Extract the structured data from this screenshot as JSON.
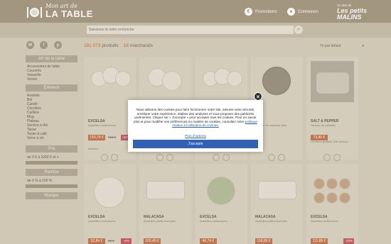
{
  "header": {
    "logo_top": "Mon art de",
    "logo_bottom": "LA TABLE",
    "promotions": "Promotions",
    "connexion": "Connexion",
    "brand_small": "Un site de",
    "brand_name": "Les petits MALINS"
  },
  "search": {
    "placeholder": "Saisissez ici votre recherche"
  },
  "results": {
    "count": "181 073",
    "products_label": "produits",
    "merchants_count": "18",
    "merchants_label": "marchands"
  },
  "sort": {
    "selected": "Tri par défaut"
  },
  "sidebar": {
    "art_title": "Art de la table",
    "art_items": [
      "Accessoires de table",
      "Couverts",
      "Vaisselle",
      "Verres"
    ],
    "element_title": "Élément",
    "element_items": [
      "Assiette",
      "Bol",
      "Carafe",
      "Cocottes",
      "Cuillère",
      "Mug",
      "Plateau",
      "Service à thé",
      "Tasse",
      "Tasse à café",
      "Verre à vin"
    ],
    "prix_title": "Prix",
    "prix_range": "de 0 € à 1000 € et +",
    "remise_title": "Remise",
    "remise_range": "de 0 % à 100 %",
    "marque_title": "Marque"
  },
  "products_row1": [
    {
      "name": "EXCELSA",
      "sub": "Assiettes multicolores",
      "price": "150,74 €",
      "old": "218 €",
      "disc": "-31%",
      "ship": "Amazon"
    },
    {
      "name": "",
      "sub": "",
      "price": "",
      "old": "",
      "disc": "",
      "ship": ""
    },
    {
      "name": "",
      "sub": "",
      "price": "",
      "old": "",
      "disc": "",
      "ship": ""
    },
    {
      "name": "",
      "sub": "Service de vaisselle Mint",
      "price": "",
      "old": "",
      "disc": "",
      "ship": ""
    },
    {
      "name": "SALT & PEPPER",
      "sub": "Service de vaisselle",
      "price": "73,40 €",
      "old": "",
      "disc": "",
      "ship": "Livraison gratuite Salt Avenue"
    }
  ],
  "products_row2": [
    {
      "name": "EXCELSA",
      "sub": "Assiettes multicolores",
      "price": "52,84 €",
      "old": "55 €",
      "disc": "-4%"
    },
    {
      "name": "MALACASA",
      "sub": "Assiettes plates blanches",
      "price": "105,40 €",
      "old": "",
      "disc": ""
    },
    {
      "name": "EXCELSA",
      "sub": "Assiettes multicolores",
      "price": "46,74 €",
      "old": "",
      "disc": ""
    },
    {
      "name": "MALACASA",
      "sub": "Assiettes plates blanches",
      "price": "118,89 €",
      "old": "",
      "disc": ""
    },
    {
      "name": "EXCELSA",
      "sub": "Assiettes multicolores",
      "price": "111,88 €",
      "old": "",
      "disc": "-10%"
    }
  ],
  "cookie": {
    "text": "Nous utilisons des cookies pour faire fonctionner notre site, assurer votre sécurité, améliorer votre expérience, réaliser des analyses et vous proposer des publicités pertinentes. Cliquer sur « J'accepte » pour accepter tous les cookies. Pour en savoir plus et pour modifier vos préférences en matière de cookies, consultez notre",
    "link": "politique relative à l'utilisation de cookies.",
    "more": "Plus d'options",
    "accept": "J'accepte",
    "close": "×"
  }
}
